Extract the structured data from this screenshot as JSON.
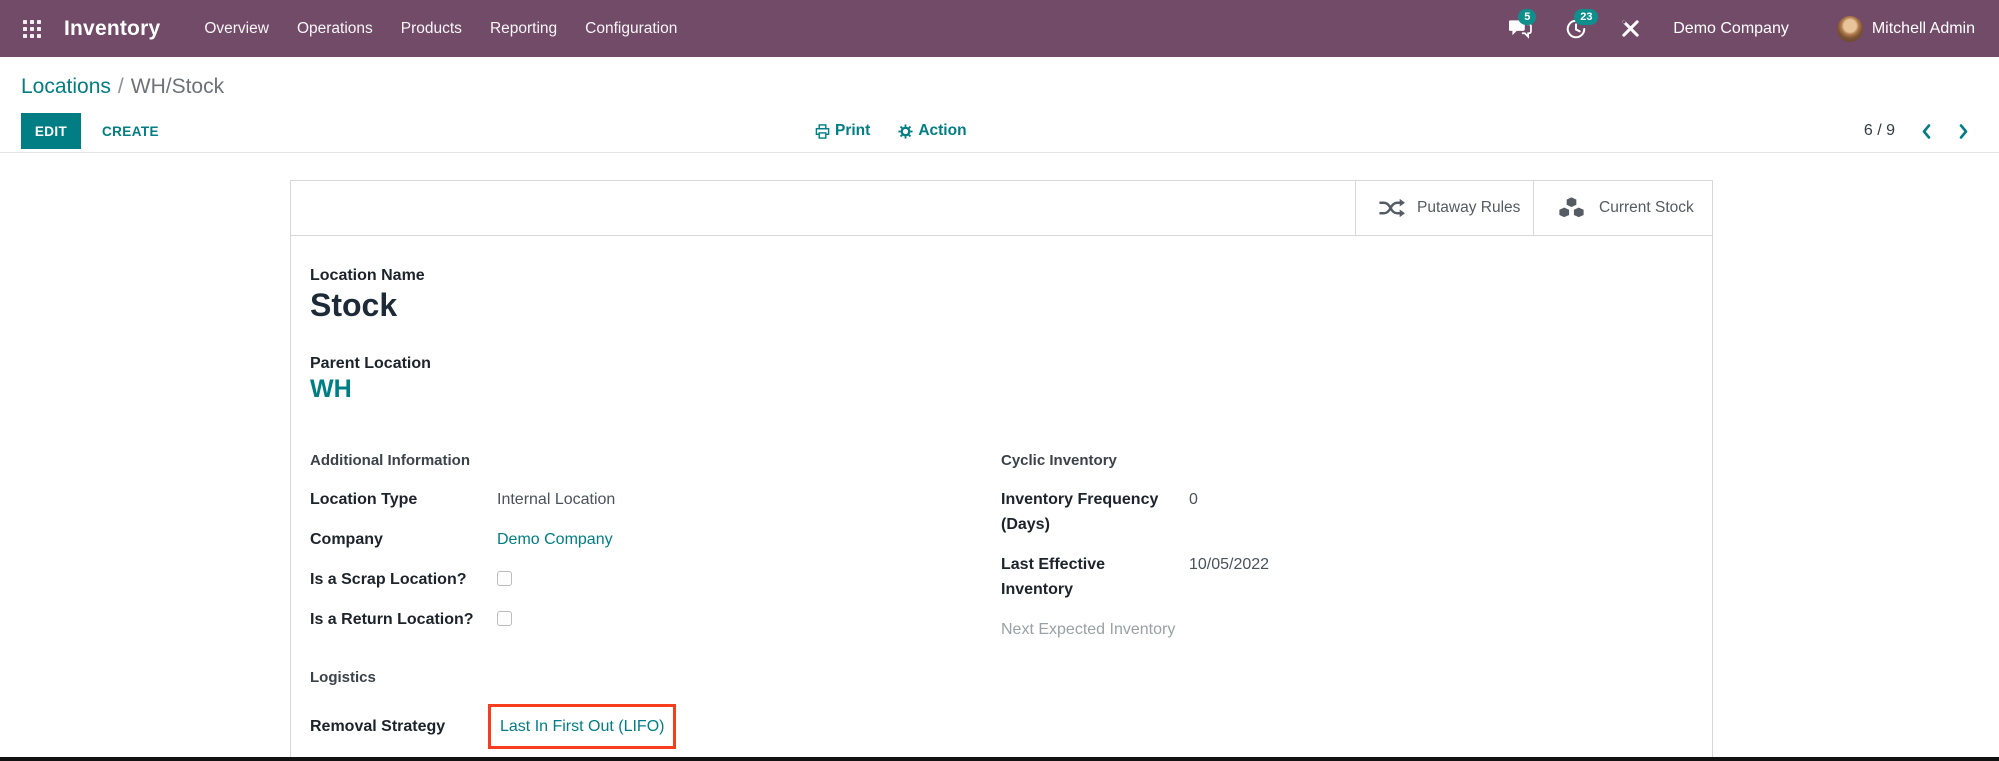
{
  "topbar": {
    "app_name": "Inventory",
    "menus": [
      "Overview",
      "Operations",
      "Products",
      "Reporting",
      "Configuration"
    ],
    "messages_badge": "5",
    "activities_badge": "23",
    "company": "Demo Company",
    "user": "Mitchell Admin"
  },
  "breadcrumb": {
    "parent": "Locations",
    "separator": "/",
    "current": "WH/Stock"
  },
  "control_panel": {
    "edit_label": "EDIT",
    "create_label": "CREATE",
    "print_label": "Print",
    "action_label": "Action",
    "pager": "6 / 9"
  },
  "smart_buttons": [
    {
      "icon": "shuffle-icon",
      "label": "Putaway Rules"
    },
    {
      "icon": "cubes-icon",
      "label": "Current Stock"
    }
  ],
  "form": {
    "location_name_label": "Location Name",
    "location_name": "Stock",
    "parent_location_label": "Parent Location",
    "parent_location": "WH",
    "sections": {
      "additional_information": {
        "title": "Additional Information",
        "fields": [
          {
            "label": "Location Type",
            "value": "Internal Location",
            "type": "text"
          },
          {
            "label": "Company",
            "value": "Demo Company",
            "type": "link"
          },
          {
            "label": "Is a Scrap Location?",
            "type": "checkbox",
            "checked": false
          },
          {
            "label": "Is a Return Location?",
            "type": "checkbox",
            "checked": false
          }
        ]
      },
      "cyclic_inventory": {
        "title": "Cyclic Inventory",
        "fields": [
          {
            "label": "Inventory Frequency (Days)",
            "value": "0",
            "type": "text"
          },
          {
            "label": "Last Effective Inventory",
            "value": "10/05/2022",
            "type": "text"
          },
          {
            "label": "Next Expected Inventory",
            "value": "",
            "type": "text",
            "muted": true
          }
        ]
      },
      "logistics": {
        "title": "Logistics",
        "fields": [
          {
            "label": "Removal Strategy",
            "value": "Last In First Out (LIFO)",
            "type": "link",
            "highlighted": true
          }
        ]
      }
    }
  },
  "colors": {
    "topbar": "#714B67",
    "accent": "#017E84",
    "badge": "#0E8F8C",
    "highlight": "#F63E1E"
  }
}
